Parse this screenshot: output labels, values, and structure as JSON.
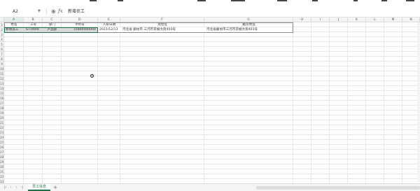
{
  "formula_bar": {
    "name_box": "A2",
    "formula_value": "新增员工"
  },
  "columns": [
    {
      "label": "A"
    },
    {
      "label": "B"
    },
    {
      "label": "C"
    },
    {
      "label": "D"
    },
    {
      "label": "E"
    },
    {
      "label": "F"
    },
    {
      "label": "G"
    },
    {
      "label": "H"
    },
    {
      "label": "I"
    },
    {
      "label": "J"
    },
    {
      "label": "K"
    },
    {
      "label": "L"
    },
    {
      "label": "M"
    },
    {
      "label": "N"
    }
  ],
  "rows": [
    "1",
    "2",
    "3",
    "4",
    "5",
    "6",
    "7",
    "8",
    "9",
    "10",
    "11",
    "12",
    "13",
    "14",
    "15",
    "16",
    "17",
    "18",
    "19",
    "20",
    "21",
    "22",
    "23",
    "24",
    "25",
    "26",
    "27",
    "28",
    "29",
    "30",
    "31",
    "32",
    "33"
  ],
  "table": {
    "headers": [
      "姓名",
      "工号",
      "部门",
      "手机号",
      "入职日期",
      "现住址",
      "籍贯地址"
    ],
    "row": [
      "新增员工",
      "ST-0000",
      "产品部",
      "15800000000",
      "2021/12/13",
      "河北省 廊坊市 三河市京榆大街403号",
      "河北省廊坊市三河市京榆大街403号"
    ]
  },
  "sheet_tabs": [
    {
      "label": "员工信息",
      "active": true
    }
  ],
  "colors": {
    "accent": "#1e7145",
    "grid": "#e6e6e6",
    "header_bg": "#f3f3f3"
  }
}
